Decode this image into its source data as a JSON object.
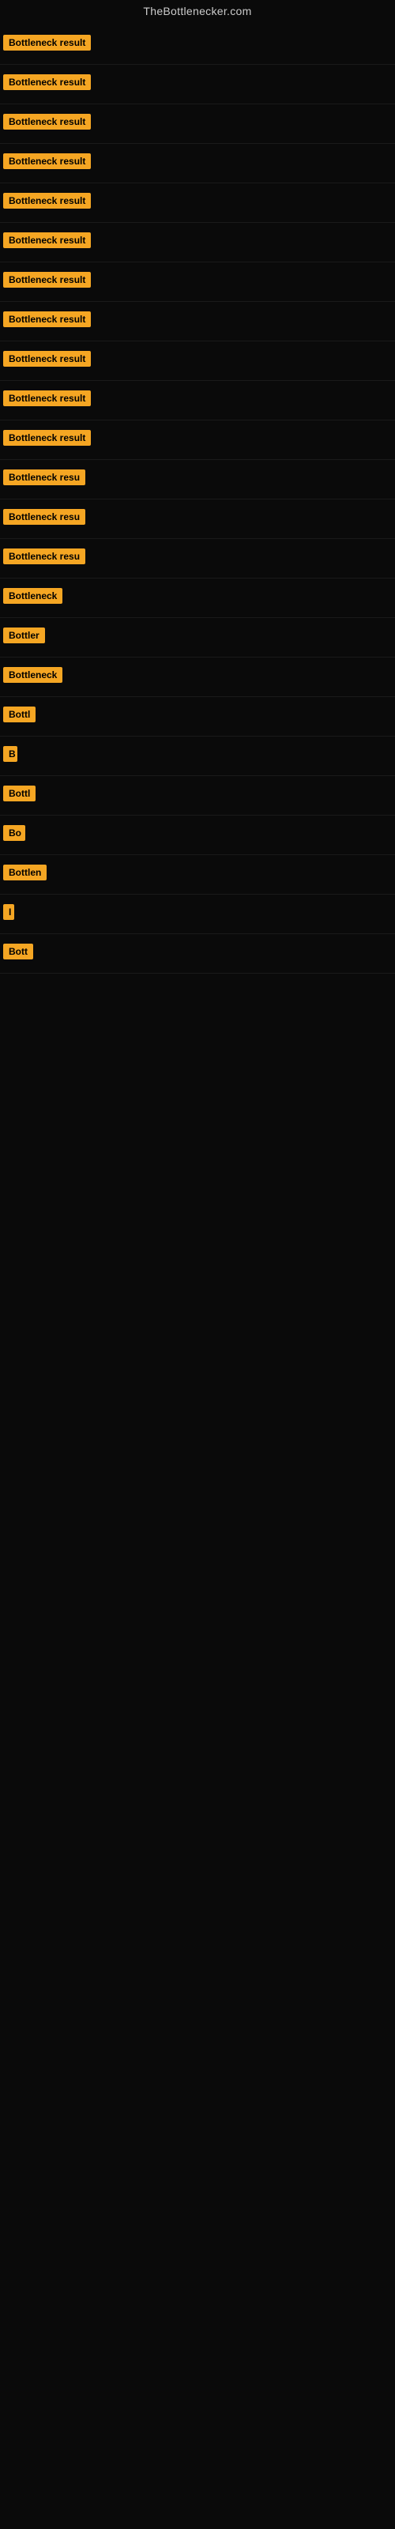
{
  "site": {
    "title": "TheBottlenecker.com"
  },
  "results": [
    {
      "label": "Bottleneck result",
      "width": 155
    },
    {
      "label": "Bottleneck result",
      "width": 155
    },
    {
      "label": "Bottleneck result",
      "width": 155
    },
    {
      "label": "Bottleneck result",
      "width": 155
    },
    {
      "label": "Bottleneck result",
      "width": 155
    },
    {
      "label": "Bottleneck result",
      "width": 155
    },
    {
      "label": "Bottleneck result",
      "width": 155
    },
    {
      "label": "Bottleneck result",
      "width": 155
    },
    {
      "label": "Bottleneck result",
      "width": 155
    },
    {
      "label": "Bottleneck result",
      "width": 155
    },
    {
      "label": "Bottleneck result",
      "width": 150
    },
    {
      "label": "Bottleneck resu",
      "width": 130
    },
    {
      "label": "Bottleneck resu",
      "width": 125
    },
    {
      "label": "Bottleneck resu",
      "width": 120
    },
    {
      "label": "Bottleneck",
      "width": 85
    },
    {
      "label": "Bottler",
      "width": 60
    },
    {
      "label": "Bottleneck",
      "width": 82
    },
    {
      "label": "Bottl",
      "width": 48
    },
    {
      "label": "B",
      "width": 18
    },
    {
      "label": "Bottl",
      "width": 48
    },
    {
      "label": "Bo",
      "width": 28
    },
    {
      "label": "Bottlen",
      "width": 65
    },
    {
      "label": "I",
      "width": 10
    },
    {
      "label": "Bott",
      "width": 42
    }
  ]
}
